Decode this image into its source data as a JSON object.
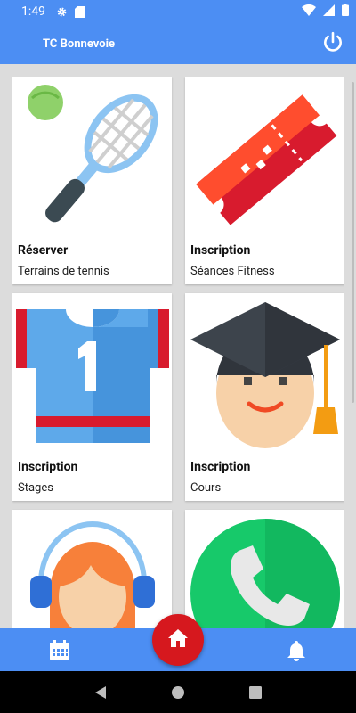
{
  "status_bar": {
    "time": "1:49"
  },
  "app_bar": {
    "title": "TC Bonnevoie"
  },
  "cards": [
    {
      "title": "Réserver",
      "subtitle": "Terrains de tennis",
      "icon": "tennis-racket-icon"
    },
    {
      "title": "Inscription",
      "subtitle": "Séances Fitness",
      "icon": "ticket-icon"
    },
    {
      "title": "Inscription",
      "subtitle": "Stages",
      "icon": "jersey-icon"
    },
    {
      "title": "Inscription",
      "subtitle": "Cours",
      "icon": "graduate-icon"
    },
    {
      "title": "",
      "subtitle": "",
      "icon": "headset-person-icon"
    },
    {
      "title": "",
      "subtitle": "",
      "icon": "phone-icon"
    }
  ],
  "colors": {
    "primary": "#4c8ef3",
    "fab": "#d6181e"
  }
}
